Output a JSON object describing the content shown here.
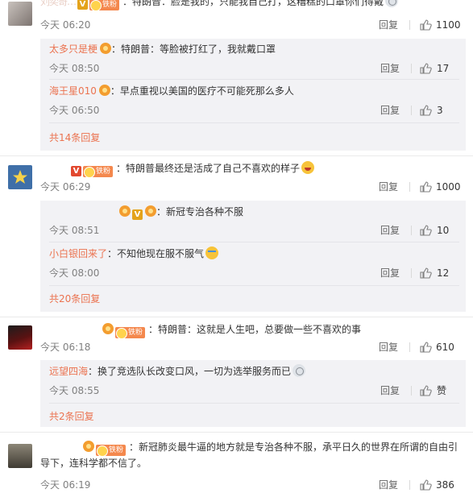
{
  "colors": {
    "link": "#eb7350",
    "meta": "#808080",
    "reply_bg": "#f2f2f5"
  },
  "comments": [
    {
      "username": "刘奕哥…",
      "text": "：特朗普：脸是我的，只能我自己打，这糟糕的口罩你们得戴",
      "time": "今天 06:20",
      "reply": "回复",
      "likes": "1100",
      "replies": [
        {
          "username": "太多只是梗",
          "text": "：特朗普：等脸被打红了，我就戴口罩",
          "time": "今天 08:50",
          "reply": "回复",
          "likes": "17"
        },
        {
          "username": "海王星010",
          "text": "：早点重视以美国的医疗不可能死那么多人",
          "time": "今天 06:50",
          "reply": "回复",
          "likes": "3"
        }
      ],
      "more": "共14条回复"
    },
    {
      "username": "",
      "text": "：特朗普最终还是活成了自己不喜欢的样子",
      "time": "今天 06:29",
      "reply": "回复",
      "likes": "1000",
      "replies": [
        {
          "username": "",
          "text": "：新冠专治各种不服",
          "time": "今天 08:51",
          "reply": "回复",
          "likes": "10"
        },
        {
          "username": "小白银回来了",
          "text": "：不知他现在服不服气",
          "time": "今天 08:00",
          "reply": "回复",
          "likes": "12"
        }
      ],
      "more": "共20条回复"
    },
    {
      "username": "",
      "text": "：特朗普：这就是人生吧，总要做一些不喜欢的事",
      "time": "今天 06:18",
      "reply": "回复",
      "likes": "610",
      "replies": [
        {
          "username": "远望四海",
          "text": "：换了竞选队长改变口风，一切为选举服务而已",
          "time": "今天 08:55",
          "reply": "回复",
          "likes": "赞"
        }
      ],
      "more": "共2条回复"
    },
    {
      "username": "",
      "text": "：新冠肺炎最牛逼的地方就是专治各种不服，承平日久的世界在所谓的自由引导下，连科学都不信了。",
      "time": "今天 06:19",
      "reply": "回复",
      "likes": "386"
    }
  ],
  "icons": {
    "like": "thumbs-up-icon",
    "vip": "v-badge-icon",
    "fan": "fan-badge-icon",
    "medal": "medal-icon"
  },
  "badges": {
    "v": "V",
    "fan": "铁粉"
  }
}
